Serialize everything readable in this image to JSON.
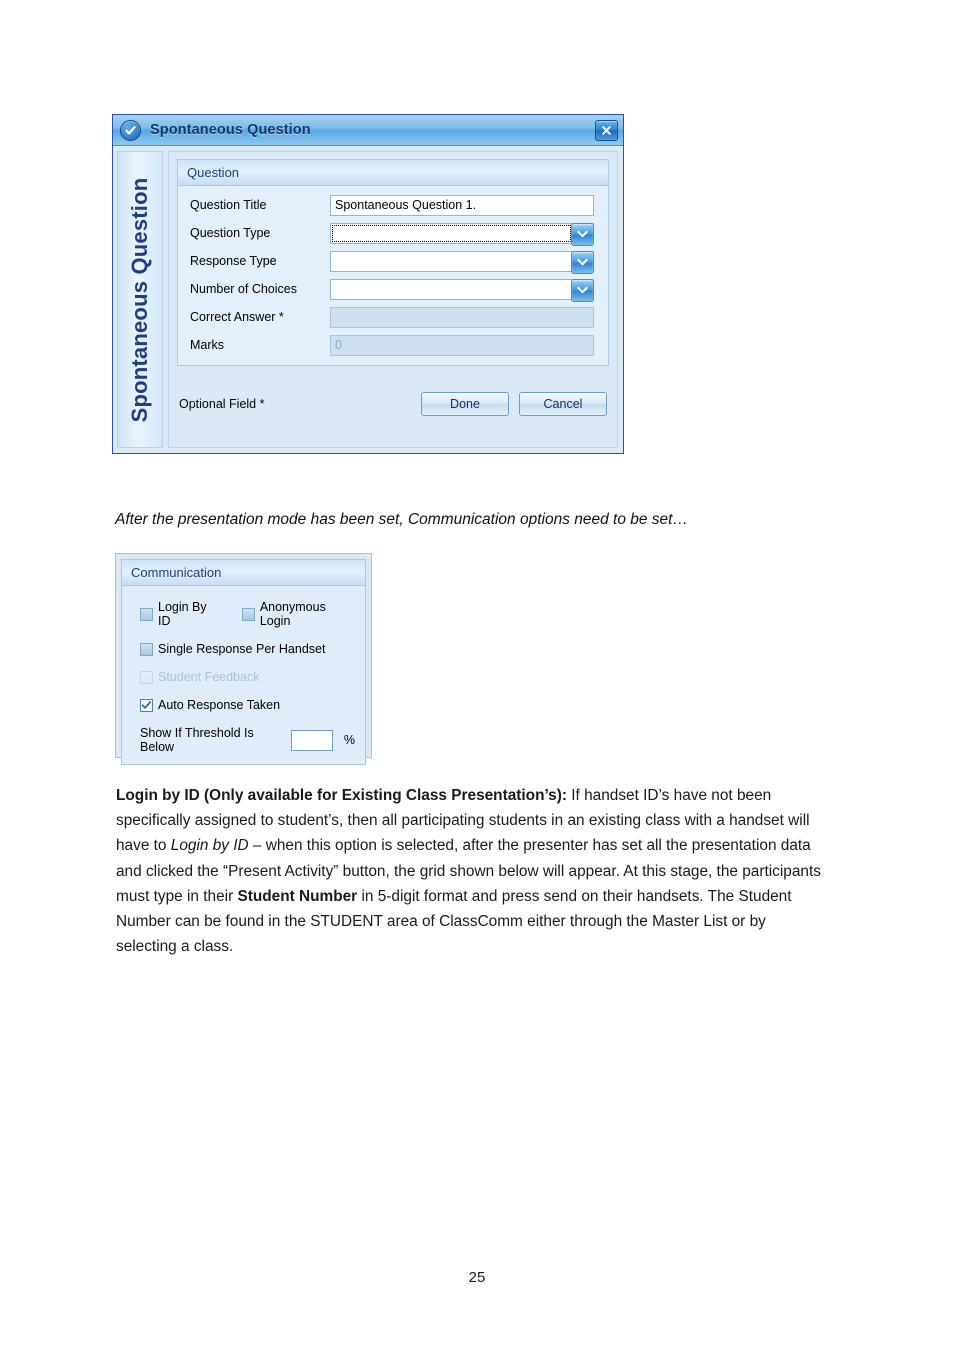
{
  "dialog": {
    "title": "Spontaneous Question",
    "icon": "check-circle-icon",
    "close_icon": "close-icon",
    "side_banner": "Spontaneous Question",
    "group_title": "Question",
    "fields": [
      {
        "label": "Question Title",
        "value": "Spontaneous Question 1.",
        "type": "text",
        "state": "enabled"
      },
      {
        "label": "Question Type",
        "value": "",
        "type": "combo",
        "state": "focused"
      },
      {
        "label": "Response Type",
        "value": "",
        "type": "combo",
        "state": "enabled"
      },
      {
        "label": "Number of Choices",
        "value": "",
        "type": "combo",
        "state": "enabled"
      },
      {
        "label": "Correct Answer *",
        "value": "",
        "type": "text",
        "state": "disabled"
      },
      {
        "label": "Marks",
        "value": "0",
        "type": "text",
        "state": "disabled"
      }
    ],
    "optional_field_note": "Optional Field *",
    "buttons": {
      "done": "Done",
      "cancel": "Cancel"
    }
  },
  "caption": "After the presentation mode has been set, Communication options need to be set…",
  "communication": {
    "group_title": "Communication",
    "checkboxes": [
      {
        "label": "Login By ID",
        "checked": false,
        "disabled": false
      },
      {
        "label": "Anonymous Login",
        "checked": false,
        "disabled": false
      },
      {
        "label": "Single Response Per Handset",
        "checked": false,
        "disabled": false
      },
      {
        "label": "Student Feedback",
        "checked": false,
        "disabled": true
      },
      {
        "label": "Auto Response Taken",
        "checked": true,
        "disabled": false
      }
    ],
    "threshold": {
      "label": "Show If Threshold Is Below",
      "value": "",
      "unit": "%"
    }
  },
  "paragraph": {
    "lead": "Login by ID (Only available for Existing Class Presentation’s):",
    "t1": " If handset ID’s have not been specifically assigned to student’s, then all participating students in an existing class with a handset will have to ",
    "em1": "Login by ID",
    "t2": " – when this option is selected, after the presenter has set all the presentation data and clicked the “Present Activity” button, the grid shown below will appear. At this stage, the participants must type in their ",
    "em2": "Student Number",
    "t3": " in 5-digit format and press send on their handsets. The Student Number can be found in the STUDENT area of ClassComm either through the Master List or by selecting a class."
  },
  "page_number": "25",
  "colors": {
    "title_bar": "#7fbceb",
    "accent_blue": "#1c3f86",
    "panel_bg": "#dbe9f7",
    "group_bg": "#e3effb"
  }
}
